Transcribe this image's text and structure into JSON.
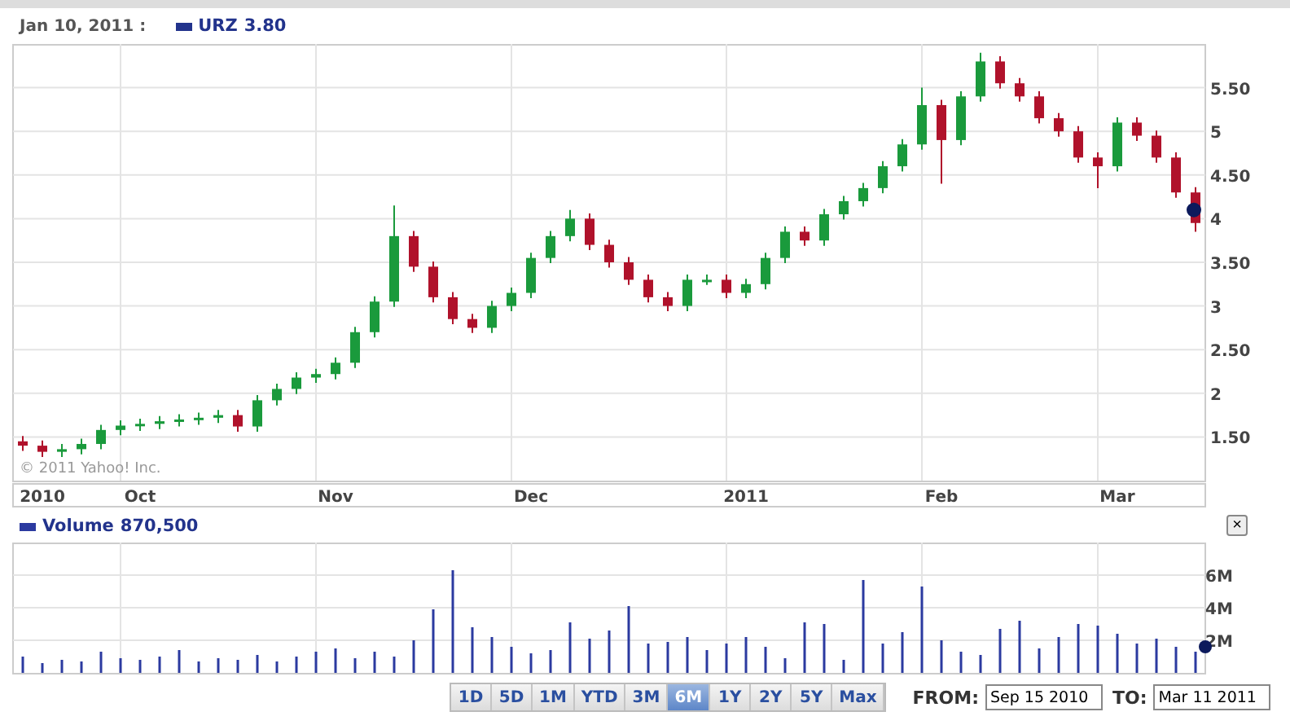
{
  "header": {
    "date": "Jan 10, 2011 :",
    "price": "3.80"
  },
  "copyright": "© 2011 Yahoo! Inc.",
  "price_chart": {
    "chart_data": {
      "type": "candlestick",
      "grid": true,
      "ylim": [
        1,
        6
      ],
      "yticks": [
        {
          "value": 1.5,
          "label": "1.50"
        },
        {
          "value": 2,
          "label": "2"
        },
        {
          "value": 2.5,
          "label": "2.50"
        },
        {
          "value": 3,
          "label": "3"
        },
        {
          "value": 3.5,
          "label": "3.50"
        },
        {
          "value": 4,
          "label": "4"
        },
        {
          "value": 4.5,
          "label": "4.50"
        },
        {
          "value": 5,
          "label": "5"
        },
        {
          "value": 5.5,
          "label": "5.50"
        }
      ],
      "categories": [
        null,
        "2010",
        null,
        null,
        null,
        null,
        "Oct",
        null,
        null,
        null,
        null,
        null,
        null,
        null,
        null,
        null,
        "Nov",
        null,
        null,
        null,
        null,
        null,
        null,
        null,
        null,
        null,
        "Dec",
        null,
        null,
        null,
        null,
        null,
        null,
        null,
        null,
        null,
        null,
        "2011",
        null,
        null,
        null,
        null,
        null,
        null,
        null,
        null,
        null,
        "Feb",
        null,
        null,
        null,
        null,
        null,
        null,
        null,
        null,
        "Mar",
        null,
        null,
        null,
        null
      ],
      "series": [
        {
          "name": "URZ",
          "ohlc": [
            [
              1.45,
              1.51,
              1.34,
              1.4
            ],
            [
              1.4,
              1.46,
              1.27,
              1.33
            ],
            [
              1.33,
              1.42,
              1.27,
              1.36
            ],
            [
              1.36,
              1.48,
              1.3,
              1.42
            ],
            [
              1.42,
              1.64,
              1.36,
              1.58
            ],
            [
              1.58,
              1.69,
              1.52,
              1.63
            ],
            [
              1.63,
              1.71,
              1.57,
              1.65
            ],
            [
              1.65,
              1.74,
              1.59,
              1.68
            ],
            [
              1.68,
              1.76,
              1.62,
              1.7
            ],
            [
              1.7,
              1.78,
              1.64,
              1.72
            ],
            [
              1.72,
              1.81,
              1.66,
              1.75
            ],
            [
              1.75,
              1.81,
              1.56,
              1.62
            ],
            [
              1.62,
              1.98,
              1.56,
              1.92
            ],
            [
              1.92,
              2.11,
              1.86,
              2.05
            ],
            [
              2.05,
              2.24,
              1.99,
              2.18
            ],
            [
              2.18,
              2.28,
              2.12,
              2.22
            ],
            [
              2.22,
              2.41,
              2.16,
              2.35
            ],
            [
              2.35,
              2.76,
              2.29,
              2.7
            ],
            [
              2.7,
              3.11,
              2.64,
              3.05
            ],
            [
              3.05,
              4.15,
              2.99,
              3.8
            ],
            [
              3.8,
              3.86,
              3.39,
              3.45
            ],
            [
              3.45,
              3.51,
              3.04,
              3.1
            ],
            [
              3.1,
              3.16,
              2.79,
              2.85
            ],
            [
              2.85,
              2.91,
              2.69,
              2.75
            ],
            [
              2.75,
              3.06,
              2.69,
              3.0
            ],
            [
              3.0,
              3.21,
              2.94,
              3.15
            ],
            [
              3.15,
              3.61,
              3.09,
              3.55
            ],
            [
              3.55,
              3.86,
              3.49,
              3.8
            ],
            [
              3.8,
              4.1,
              3.74,
              4.0
            ],
            [
              4.0,
              4.06,
              3.64,
              3.7
            ],
            [
              3.7,
              3.76,
              3.44,
              3.5
            ],
            [
              3.5,
              3.56,
              3.24,
              3.3
            ],
            [
              3.3,
              3.36,
              3.04,
              3.1
            ],
            [
              3.1,
              3.16,
              2.94,
              3.0
            ],
            [
              3.0,
              3.36,
              2.94,
              3.3
            ],
            [
              3.3,
              3.36,
              3.24,
              3.3
            ],
            [
              3.3,
              3.36,
              3.09,
              3.15
            ],
            [
              3.15,
              3.31,
              3.09,
              3.25
            ],
            [
              3.25,
              3.61,
              3.19,
              3.55
            ],
            [
              3.55,
              3.91,
              3.49,
              3.85
            ],
            [
              3.85,
              3.91,
              3.69,
              3.75
            ],
            [
              3.75,
              4.11,
              3.69,
              4.05
            ],
            [
              4.05,
              4.26,
              3.99,
              4.2
            ],
            [
              4.2,
              4.41,
              4.14,
              4.35
            ],
            [
              4.35,
              4.66,
              4.29,
              4.6
            ],
            [
              4.6,
              4.91,
              4.54,
              4.85
            ],
            [
              4.85,
              5.5,
              4.79,
              5.3
            ],
            [
              5.3,
              5.36,
              4.4,
              4.9
            ],
            [
              4.9,
              5.46,
              4.84,
              5.4
            ],
            [
              5.4,
              5.9,
              5.34,
              5.8
            ],
            [
              5.8,
              5.86,
              5.49,
              5.55
            ],
            [
              5.55,
              5.61,
              5.34,
              5.4
            ],
            [
              5.4,
              5.46,
              5.09,
              5.15
            ],
            [
              5.15,
              5.21,
              4.94,
              5.0
            ],
            [
              5.0,
              5.06,
              4.64,
              4.7
            ],
            [
              4.7,
              4.76,
              4.35,
              4.6
            ],
            [
              4.6,
              5.16,
              4.54,
              5.1
            ],
            [
              5.1,
              5.16,
              4.89,
              4.95
            ],
            [
              4.95,
              5.01,
              4.64,
              4.7
            ],
            [
              4.7,
              4.76,
              4.24,
              4.3
            ],
            [
              4.3,
              4.36,
              3.85,
              3.95
            ]
          ]
        }
      ]
    }
  },
  "volume": {
    "value": "870,500",
    "close": "×",
    "chart_data": {
      "type": "bar",
      "grid": true,
      "ylim": [
        0,
        8
      ],
      "yticks": [
        {
          "value": 2,
          "label": "2M"
        },
        {
          "value": 4,
          "label": "4M"
        },
        {
          "value": 6,
          "label": "6M"
        }
      ],
      "series": [
        {
          "name": "Volume",
          "color": "#2b3aa0",
          "values": [
            1.0,
            0.6,
            0.8,
            0.7,
            1.3,
            0.9,
            0.8,
            1.0,
            1.4,
            0.7,
            0.9,
            0.8,
            1.1,
            0.7,
            1.0,
            1.3,
            1.5,
            0.9,
            1.3,
            1.0,
            2.0,
            3.9,
            6.3,
            2.8,
            2.2,
            1.6,
            1.2,
            1.4,
            3.1,
            2.1,
            2.6,
            4.1,
            1.8,
            1.9,
            2.2,
            1.4,
            1.8,
            2.2,
            1.6,
            0.9,
            3.1,
            3.0,
            0.8,
            5.7,
            1.8,
            2.5,
            5.3,
            2.0,
            1.3,
            1.1,
            2.7,
            3.2,
            1.5,
            2.2,
            3.0,
            2.9,
            2.4,
            1.8,
            2.1,
            1.6,
            1.3
          ]
        }
      ]
    }
  },
  "ranges": [
    {
      "label": "1D",
      "selected": false
    },
    {
      "label": "5D",
      "selected": false
    },
    {
      "label": "1M",
      "selected": false
    },
    {
      "label": "YTD",
      "selected": false
    },
    {
      "label": "3M",
      "selected": false
    },
    {
      "label": "6M",
      "selected": true
    },
    {
      "label": "1Y",
      "selected": false
    },
    {
      "label": "2Y",
      "selected": false
    },
    {
      "label": "5Y",
      "selected": false
    },
    {
      "label": "Max",
      "selected": false
    }
  ],
  "from": {
    "label": "FROM:",
    "value": "Sep 15 2010"
  },
  "to": {
    "label": "TO:",
    "value": "Mar 11 2011"
  }
}
